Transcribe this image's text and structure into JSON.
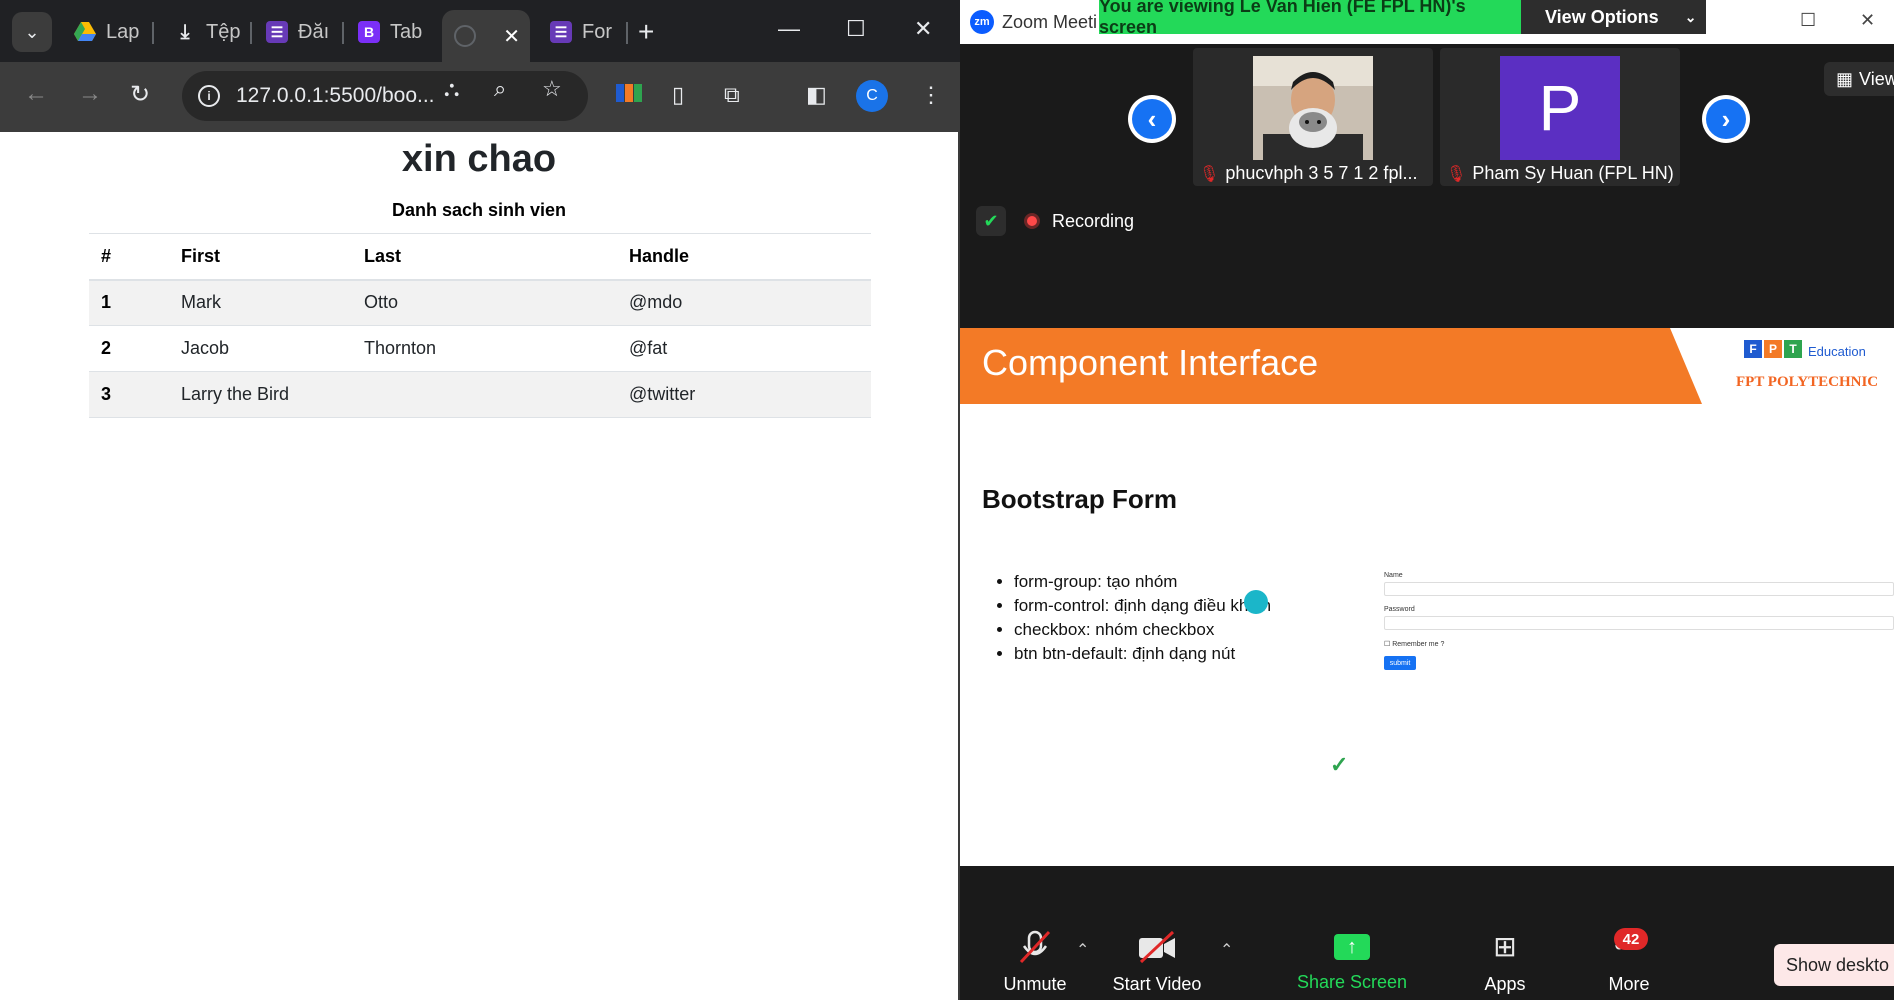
{
  "browser": {
    "tabs": [
      {
        "label": "Lap",
        "favicon_color": "#1a73e8"
      },
      {
        "label": "Tệp",
        "favicon_color": "#202124"
      },
      {
        "label": "Đăı",
        "favicon_color": "#673ab7"
      },
      {
        "label": "Tab",
        "favicon_color": "#7b2ff7"
      },
      {
        "label": "",
        "favicon_color": "#5f6368"
      },
      {
        "label": "For",
        "favicon_color": "#673ab7"
      }
    ],
    "address": "127.0.0.1:5500/boo...",
    "profile_initial": "C"
  },
  "page": {
    "heading": "xin chao",
    "caption": "Danh sach sinh vien",
    "columns": [
      "#",
      "First",
      "Last",
      "Handle"
    ],
    "rows": [
      [
        "1",
        "Mark",
        "Otto",
        "@mdo"
      ],
      [
        "2",
        "Jacob",
        "Thornton",
        "@fat"
      ],
      [
        "3",
        "Larry the Bird",
        "",
        "@twitter"
      ]
    ]
  },
  "zoom": {
    "title": "Zoom Meeti",
    "logo": "zm",
    "viewing_banner": "You are viewing Le Van Hien (FE FPL HN)'s screen",
    "view_options": "View Options",
    "gallery_label": "View",
    "participants": [
      {
        "name": "phucvhph 3 5 7 1 2 fpl...",
        "avatar_type": "photo"
      },
      {
        "name": "Pham Sy Huan (FPL HN)",
        "avatar_letter": "P",
        "avatar_color": "#5b2fc2"
      }
    ],
    "recording": "Recording",
    "slide": {
      "title": "Component Interface",
      "logo_education": "Education",
      "logo_letters": [
        "F",
        "P",
        "T"
      ],
      "logo_name": "FPT POLYTECHNIC",
      "section": "Bootstrap Form",
      "bullets": [
        "form-group: tạo nhóm",
        "form-control: định dạng điều khiển",
        "checkbox: nhóm checkbox",
        "btn btn-default: định dạng nút"
      ],
      "mini_form": {
        "name_label": "Name",
        "password_label": "Password",
        "remember_label": "Remember me ?",
        "submit_label": "submit"
      }
    },
    "controls": {
      "unmute": "Unmute",
      "start_video": "Start Video",
      "share_screen": "Share Screen",
      "apps": "Apps",
      "more": "More",
      "more_badge": "42",
      "show_desktop": "Show deskto"
    }
  }
}
